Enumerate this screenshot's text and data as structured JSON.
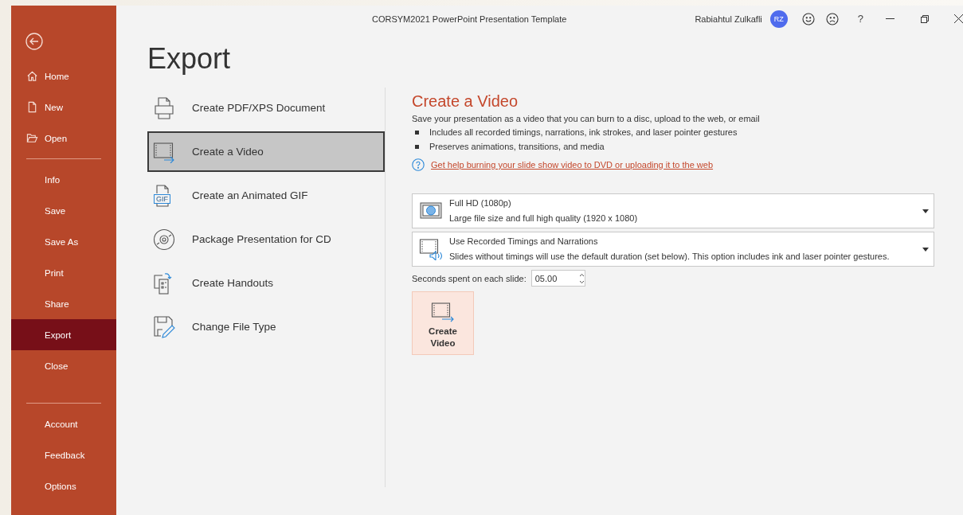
{
  "window": {
    "title": "CORSYM2021 PowerPoint Presentation Template",
    "user_name": "Rabiahtul Zulkafli",
    "avatar_initials": "RZ",
    "help_button": "?"
  },
  "sidebar": {
    "groups": [
      [
        {
          "label": "Home",
          "selected": false
        },
        {
          "label": "New",
          "selected": false
        },
        {
          "label": "Open",
          "selected": false
        }
      ],
      [
        {
          "label": "Info",
          "selected": false
        },
        {
          "label": "Save",
          "selected": false
        },
        {
          "label": "Save As",
          "selected": false
        },
        {
          "label": "Print",
          "selected": false
        },
        {
          "label": "Share",
          "selected": false
        },
        {
          "label": "Export",
          "selected": true
        },
        {
          "label": "Close",
          "selected": false
        }
      ],
      [
        {
          "label": "Account",
          "selected": false
        },
        {
          "label": "Feedback",
          "selected": false
        },
        {
          "label": "Options",
          "selected": false
        }
      ]
    ]
  },
  "page_title": "Export",
  "export_options": [
    {
      "label": "Create PDF/XPS Document",
      "selected": false
    },
    {
      "label": "Create a Video",
      "selected": true
    },
    {
      "label": "Create an Animated GIF",
      "selected": false,
      "icon_text": "GIF"
    },
    {
      "label": "Package Presentation for CD",
      "selected": false
    },
    {
      "label": "Create Handouts",
      "selected": false
    },
    {
      "label": "Change File Type",
      "selected": false
    }
  ],
  "detail": {
    "heading": "Create a Video",
    "description": "Save your presentation as a video that you can burn to a disc, upload to the web, or email",
    "bullets": [
      "Includes all recorded timings, narrations, ink strokes, and laser pointer gestures",
      "Preserves animations, transitions, and media"
    ],
    "help_link": "Get help burning your slide show video to DVD or uploading it to the web",
    "dropdowns": [
      {
        "title": "Full HD (1080p)",
        "description": "Large file size and full high quality (1920 x 1080)"
      },
      {
        "title": "Use Recorded Timings and Narrations",
        "description": "Slides without timings will use the default duration (set below). This option includes ink and laser pointer gestures."
      }
    ],
    "seconds": {
      "label": "Seconds spent on each slide:",
      "value": "05.00"
    },
    "create_button": "Create Video"
  }
}
